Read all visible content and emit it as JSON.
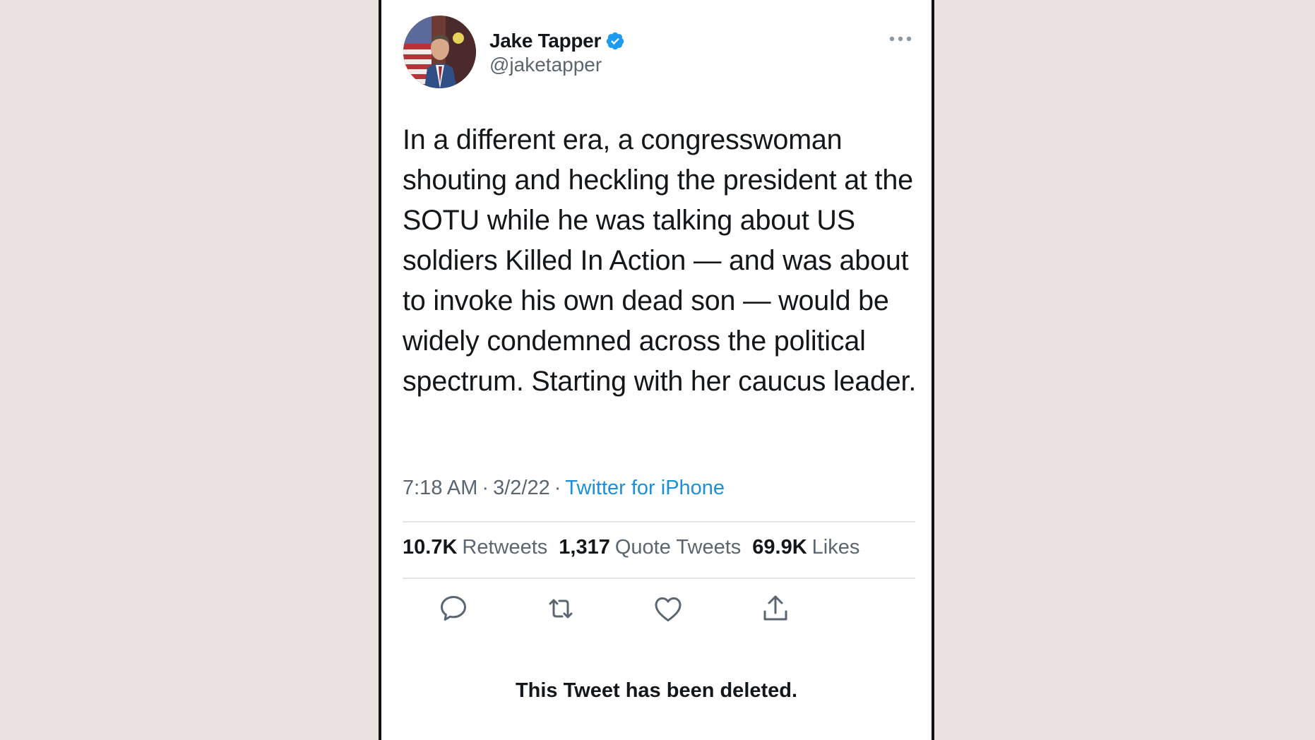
{
  "tweet": {
    "author": {
      "display_name": "Jake Tapper",
      "handle": "@jaketapper",
      "verified": true,
      "avatar_icon": "profile-photo"
    },
    "text": "In a different era, a congresswoman shouting and heckling the president at the SOTU while he was talking about US soldiers Killed In Action — and was about to invoke his own dead son — would be widely condemned across the political spectrum. Starting with her caucus leader.",
    "time": "7:18 AM",
    "date": "3/2/22",
    "separator": "·",
    "source": "Twitter for iPhone",
    "stats": {
      "retweets_count": "10.7K",
      "retweets_label": "Retweets",
      "quotes_count": "1,317",
      "quotes_label": "Quote Tweets",
      "likes_count": "69.9K",
      "likes_label": "Likes"
    },
    "actions": [
      "reply-icon",
      "retweet-icon",
      "like-icon",
      "share-icon"
    ],
    "deleted_notice": "This Tweet has been deleted."
  },
  "colors": {
    "page_background": "#ebe3e1",
    "card_background": "#ffffff",
    "link": "#1b90d8",
    "verified_badge": "#1d9bf0",
    "secondary_text": "#5b6670",
    "primary_text": "#14171a"
  }
}
